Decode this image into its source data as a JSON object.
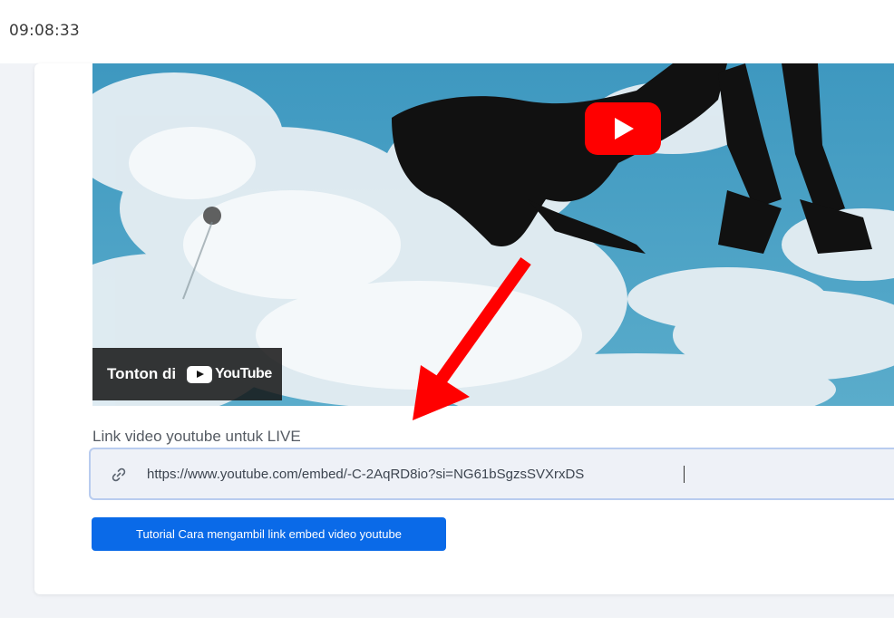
{
  "status_bar": {
    "time": "09:08:33"
  },
  "video_embed": {
    "watch_on_label": "Tonton di",
    "platform_name": "YouTube",
    "play_icon": "play-icon"
  },
  "live_link": {
    "label": "Link video youtube untuk LIVE",
    "value": "https://www.youtube.com/embed/-C-2AqRD8io?si=NG61bSgzsSVXrxDS",
    "icon": "link-icon"
  },
  "tutorial_button": {
    "label": "Tutorial Cara mengambil link embed video youtube"
  },
  "annotation": {
    "arrow_color": "#ff0000"
  },
  "colors": {
    "accent": "#0a6ae8",
    "youtube_red": "#ff0000"
  }
}
